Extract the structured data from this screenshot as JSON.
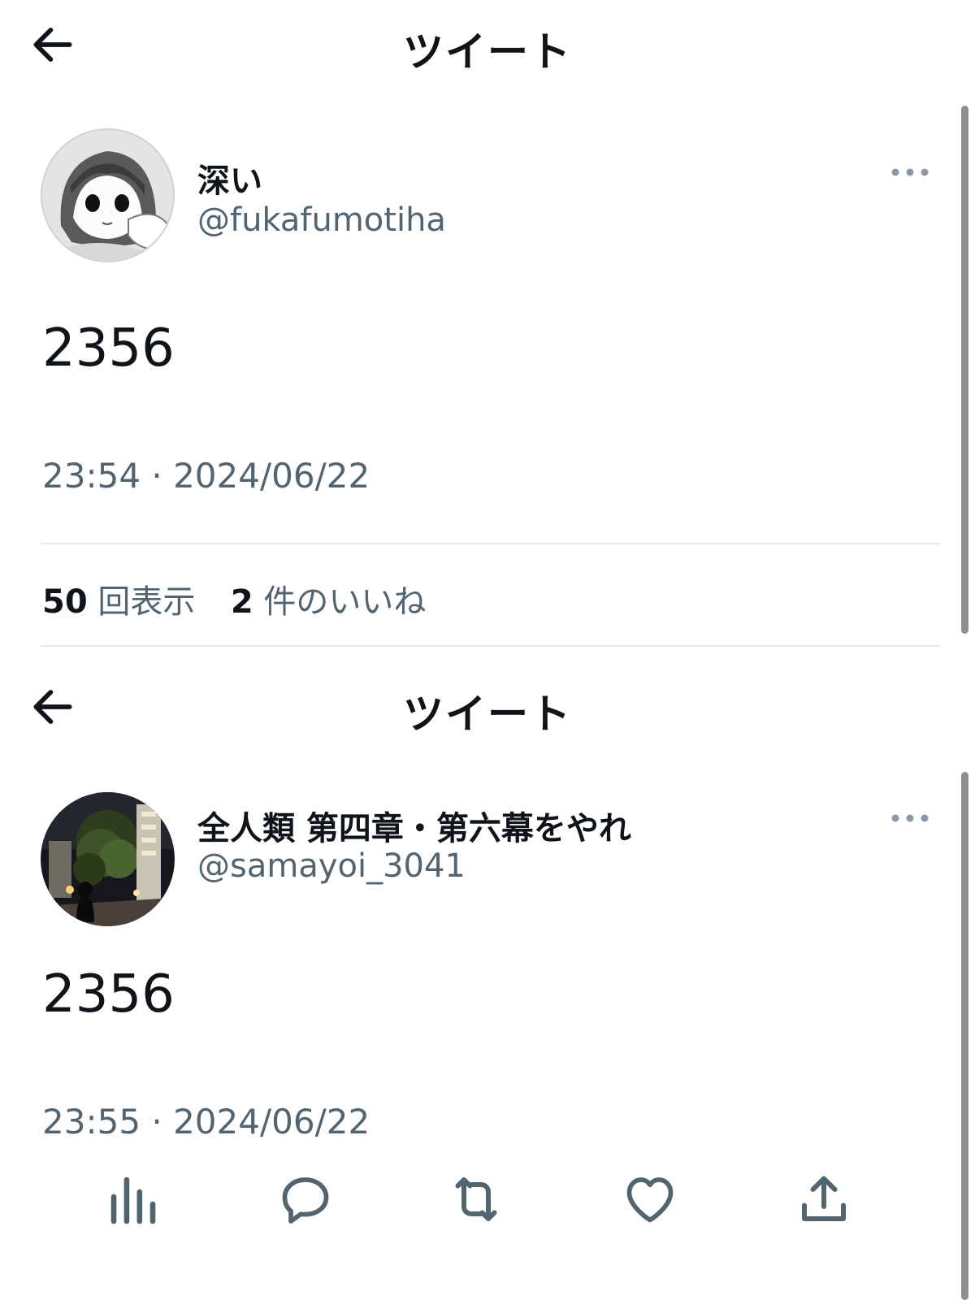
{
  "screens": [
    {
      "header_title": "ツイート",
      "display_name": "深い",
      "handle": "@fukafumotiha",
      "tweet_text": "2356",
      "timestamp": "23:54 · 2024/06/22",
      "stats": {
        "views_count": "50",
        "views_label": "回表示",
        "likes_count": "2",
        "likes_label": "件のいいね"
      }
    },
    {
      "header_title": "ツイート",
      "display_name": "全人類 第四章・第六幕をやれ",
      "handle": "@samayoi_3041",
      "tweet_text": "2356",
      "timestamp": "23:55 · 2024/06/22"
    }
  ],
  "action_bar": {
    "icons": [
      "analytics-icon",
      "reply-icon",
      "retweet-icon",
      "like-icon",
      "share-icon"
    ]
  },
  "colors": {
    "text_primary": "#0f1419",
    "text_secondary": "#536471",
    "icon_gray": "#536471",
    "divider": "#e6e9ec",
    "scrollbar": "#8e8e93"
  }
}
